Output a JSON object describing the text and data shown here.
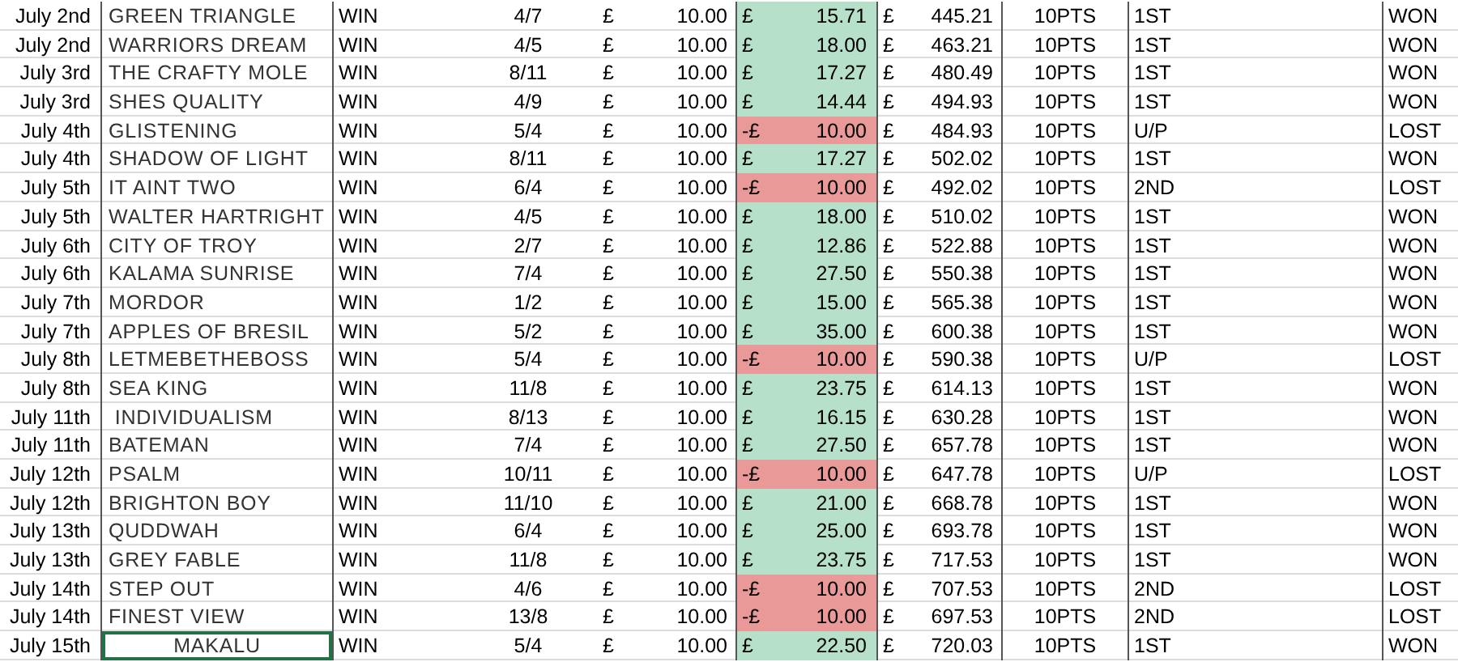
{
  "rows": [
    {
      "date": "July 2nd",
      "horse": "GREEN TRIANGLE",
      "bet": "WIN",
      "odds": "4/7",
      "stake_currency": "£",
      "stake": "10.00",
      "kind": "gain",
      "profit_currency": "£",
      "profit": "15.71",
      "balance_currency": "£",
      "balance": "445.21",
      "points": "10PTS",
      "position": "1ST",
      "result": "WON"
    },
    {
      "date": "July 2nd",
      "horse": "WARRIORS DREAM",
      "bet": "WIN",
      "odds": "4/5",
      "stake_currency": "£",
      "stake": "10.00",
      "kind": "gain",
      "profit_currency": "£",
      "profit": "18.00",
      "balance_currency": "£",
      "balance": "463.21",
      "points": "10PTS",
      "position": "1ST",
      "result": "WON"
    },
    {
      "date": "July 3rd",
      "horse": "THE CRAFTY MOLE",
      "bet": "WIN",
      "odds": "8/11",
      "stake_currency": "£",
      "stake": "10.00",
      "kind": "gain",
      "profit_currency": "£",
      "profit": "17.27",
      "balance_currency": "£",
      "balance": "480.49",
      "points": "10PTS",
      "position": "1ST",
      "result": "WON"
    },
    {
      "date": "July 3rd",
      "horse": "SHES QUALITY",
      "bet": "WIN",
      "odds": "4/9",
      "stake_currency": "£",
      "stake": "10.00",
      "kind": "gain",
      "profit_currency": "£",
      "profit": "14.44",
      "balance_currency": "£",
      "balance": "494.93",
      "points": "10PTS",
      "position": "1ST",
      "result": "WON"
    },
    {
      "date": "July 4th",
      "horse": "GLISTENING",
      "bet": "WIN",
      "odds": "5/4",
      "stake_currency": "£",
      "stake": "10.00",
      "kind": "loss",
      "profit_currency": "-£",
      "profit": "10.00",
      "balance_currency": "£",
      "balance": "484.93",
      "points": "10PTS",
      "position": "U/P",
      "result": "LOST"
    },
    {
      "date": "July 4th",
      "horse": "SHADOW OF LIGHT",
      "bet": "WIN",
      "odds": "8/11",
      "stake_currency": "£",
      "stake": "10.00",
      "kind": "gain",
      "profit_currency": "£",
      "profit": "17.27",
      "balance_currency": "£",
      "balance": "502.02",
      "points": "10PTS",
      "position": "1ST",
      "result": "WON"
    },
    {
      "date": "July 5th",
      "horse": "IT AINT TWO",
      "bet": "WIN",
      "odds": "6/4",
      "stake_currency": "£",
      "stake": "10.00",
      "kind": "loss",
      "profit_currency": "-£",
      "profit": "10.00",
      "balance_currency": "£",
      "balance": "492.02",
      "points": "10PTS",
      "position": "2ND",
      "result": "LOST"
    },
    {
      "date": "July 5th",
      "horse": "WALTER HARTRIGHT",
      "bet": "WIN",
      "odds": "4/5",
      "stake_currency": "£",
      "stake": "10.00",
      "kind": "gain",
      "profit_currency": "£",
      "profit": "18.00",
      "balance_currency": "£",
      "balance": "510.02",
      "points": "10PTS",
      "position": "1ST",
      "result": "WON"
    },
    {
      "date": "July 6th",
      "horse": "CITY OF TROY",
      "bet": "WIN",
      "odds": "2/7",
      "stake_currency": "£",
      "stake": "10.00",
      "kind": "gain",
      "profit_currency": "£",
      "profit": "12.86",
      "balance_currency": "£",
      "balance": "522.88",
      "points": "10PTS",
      "position": "1ST",
      "result": "WON"
    },
    {
      "date": "July 6th",
      "horse": "KALAMA SUNRISE",
      "bet": "WIN",
      "odds": "7/4",
      "stake_currency": "£",
      "stake": "10.00",
      "kind": "gain",
      "profit_currency": "£",
      "profit": "27.50",
      "balance_currency": "£",
      "balance": "550.38",
      "points": "10PTS",
      "position": "1ST",
      "result": "WON"
    },
    {
      "date": "July 7th",
      "horse": "MORDOR",
      "bet": "WIN",
      "odds": "1/2",
      "stake_currency": "£",
      "stake": "10.00",
      "kind": "gain",
      "profit_currency": "£",
      "profit": "15.00",
      "balance_currency": "£",
      "balance": "565.38",
      "points": "10PTS",
      "position": "1ST",
      "result": "WON"
    },
    {
      "date": "July 7th",
      "horse": "APPLES OF BRESIL",
      "bet": "WIN",
      "odds": "5/2",
      "stake_currency": "£",
      "stake": "10.00",
      "kind": "gain",
      "profit_currency": "£",
      "profit": "35.00",
      "balance_currency": "£",
      "balance": "600.38",
      "points": "10PTS",
      "position": "1ST",
      "result": "WON"
    },
    {
      "date": "July 8th",
      "horse": "LETMEBETHEBOSS",
      "bet": "WIN",
      "odds": "5/4",
      "stake_currency": "£",
      "stake": "10.00",
      "kind": "loss",
      "profit_currency": "-£",
      "profit": "10.00",
      "balance_currency": "£",
      "balance": "590.38",
      "points": "10PTS",
      "position": "U/P",
      "result": "LOST"
    },
    {
      "date": "July 8th",
      "horse": "SEA KING",
      "bet": "WIN",
      "odds": "11/8",
      "stake_currency": "£",
      "stake": "10.00",
      "kind": "gain",
      "profit_currency": "£",
      "profit": "23.75",
      "balance_currency": "£",
      "balance": "614.13",
      "points": "10PTS",
      "position": "1ST",
      "result": "WON"
    },
    {
      "date": "July 11th",
      "horse": " INDIVIDUALISM",
      "bet": "WIN",
      "odds": "8/13",
      "stake_currency": "£",
      "stake": "10.00",
      "kind": "gain",
      "profit_currency": "£",
      "profit": "16.15",
      "balance_currency": "£",
      "balance": "630.28",
      "points": "10PTS",
      "position": "1ST",
      "result": "WON"
    },
    {
      "date": "July 11th",
      "horse": "BATEMAN",
      "bet": "WIN",
      "odds": "7/4",
      "stake_currency": "£",
      "stake": "10.00",
      "kind": "gain",
      "profit_currency": "£",
      "profit": "27.50",
      "balance_currency": "£",
      "balance": "657.78",
      "points": "10PTS",
      "position": "1ST",
      "result": "WON"
    },
    {
      "date": "July 12th",
      "horse": "PSALM",
      "bet": "WIN",
      "odds": "10/11",
      "stake_currency": "£",
      "stake": "10.00",
      "kind": "loss",
      "profit_currency": "-£",
      "profit": "10.00",
      "balance_currency": "£",
      "balance": "647.78",
      "points": "10PTS",
      "position": "U/P",
      "result": "LOST"
    },
    {
      "date": "July 12th",
      "horse": "BRIGHTON BOY",
      "bet": "WIN",
      "odds": "11/10",
      "stake_currency": "£",
      "stake": "10.00",
      "kind": "gain",
      "profit_currency": "£",
      "profit": "21.00",
      "balance_currency": "£",
      "balance": "668.78",
      "points": "10PTS",
      "position": "1ST",
      "result": "WON"
    },
    {
      "date": "July 13th",
      "horse": "QUDDWAH",
      "bet": "WIN",
      "odds": "6/4",
      "stake_currency": "£",
      "stake": "10.00",
      "kind": "gain",
      "profit_currency": "£",
      "profit": "25.00",
      "balance_currency": "£",
      "balance": "693.78",
      "points": "10PTS",
      "position": "1ST",
      "result": "WON"
    },
    {
      "date": "July 13th",
      "horse": "GREY FABLE",
      "bet": "WIN",
      "odds": "11/8",
      "stake_currency": "£",
      "stake": "10.00",
      "kind": "gain",
      "profit_currency": "£",
      "profit": "23.75",
      "balance_currency": "£",
      "balance": "717.53",
      "points": "10PTS",
      "position": "1ST",
      "result": "WON"
    },
    {
      "date": "July 14th",
      "horse": "STEP OUT",
      "bet": "WIN",
      "odds": "4/6",
      "stake_currency": "£",
      "stake": "10.00",
      "kind": "loss",
      "profit_currency": "-£",
      "profit": "10.00",
      "balance_currency": "£",
      "balance": "707.53",
      "points": "10PTS",
      "position": "2ND",
      "result": "LOST"
    },
    {
      "date": "July 14th",
      "horse": "FINEST VIEW",
      "bet": "WIN",
      "odds": "13/8",
      "stake_currency": "£",
      "stake": "10.00",
      "kind": "loss",
      "profit_currency": "-£",
      "profit": "10.00",
      "balance_currency": "£",
      "balance": "697.53",
      "points": "10PTS",
      "position": "2ND",
      "result": "LOST"
    },
    {
      "date": "July 15th",
      "horse": "MAKALU",
      "horse_centered": true,
      "horse_selected": true,
      "bet": "WIN",
      "odds": "5/4",
      "stake_currency": "£",
      "stake": "10.00",
      "kind": "gain",
      "profit_currency": "£",
      "profit": "22.50",
      "balance_currency": "£",
      "balance": "720.03",
      "points": "10PTS",
      "position": "1ST",
      "result": "WON"
    }
  ]
}
